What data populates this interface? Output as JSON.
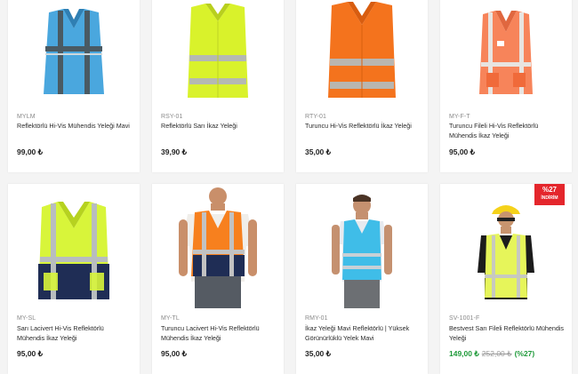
{
  "products": [
    {
      "sku": "MYLM",
      "title": "Reflektörlü Hi-Vis Mühendis Yeleği Mavi",
      "price": "99,00 ₺",
      "image_icon": "blue-vest-image"
    },
    {
      "sku": "RSY-01",
      "title": "Reflektörlü Sarı İkaz Yeleği",
      "price": "39,90 ₺",
      "image_icon": "yellow-vest-image"
    },
    {
      "sku": "RTY-01",
      "title": "Turuncu Hi-Vis Reflektörlü İkaz Yeleği",
      "price": "35,00 ₺",
      "image_icon": "orange-vest-image"
    },
    {
      "sku": "MY-F-T",
      "title": "Turuncu Fileli Hi-Vis Reflektörlü Mühendis İkaz Yeleği",
      "price": "95,00 ₺",
      "image_icon": "orange-mesh-vest-image"
    },
    {
      "sku": "MY-SL",
      "title": "Sarı Lacivert Hi-Vis Reflektörlü Mühendis İkaz Yeleği",
      "price": "95,00 ₺",
      "image_icon": "yellow-navy-vest-image"
    },
    {
      "sku": "MY-TL",
      "title": "Turuncu Lacivert Hi-Vis Reflektörlü Mühendis İkaz Yeleği",
      "price": "95,00 ₺",
      "image_icon": "orange-navy-vest-model-image"
    },
    {
      "sku": "RMY-01",
      "title": "İkaz Yeleği Mavi Reflektörlü | Yüksek Görünürlüklü Yelek Mavi",
      "price": "35,00 ₺",
      "image_icon": "blue-vest-model-image"
    },
    {
      "sku": "SV-1001-F",
      "title": "Bestvest Sarı Fileli Reflektörlü Mühendis Yeleği",
      "price": "149,00 ₺",
      "old_price": "252,00 ₺",
      "discount_text": "(%27)",
      "image_icon": "yellow-mesh-vest-model-image",
      "badge": {
        "percent": "%27",
        "label": "İNDİRİM"
      }
    }
  ],
  "colors": {
    "sale_price": "#1f9a3a",
    "badge_bg": "#e4262c"
  }
}
